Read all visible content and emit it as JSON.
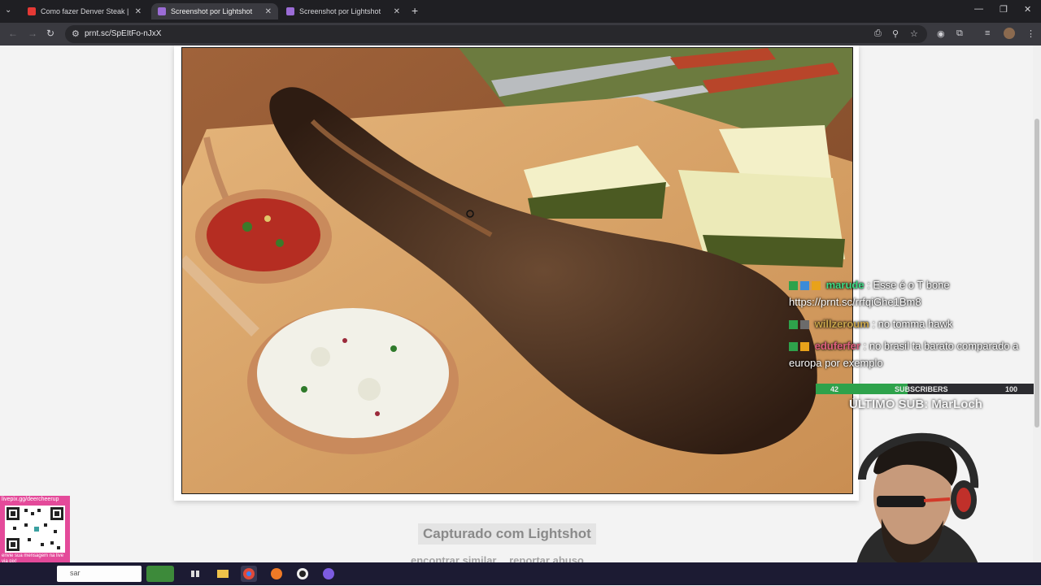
{
  "browser": {
    "tabs": [
      {
        "title": "Como fazer Denver Steak | Netf",
        "favicon_color": "#e53935",
        "active": false
      },
      {
        "title": "Screenshot por Lightshot",
        "favicon_color": "#9b6cd6",
        "active": true
      },
      {
        "title": "Screenshot por Lightshot",
        "favicon_color": "#9b6cd6",
        "active": false
      }
    ],
    "tab_close": "✕",
    "new_tab": "+",
    "window_controls": {
      "minimize": "—",
      "restore": "❐",
      "close": "✕"
    },
    "url": "prnt.sc/SpEItFo-nJxX"
  },
  "page": {
    "caption": "Capturado com Lightshot",
    "links": [
      "encontrar similar",
      "reportar abuso"
    ]
  },
  "stream": {
    "chat": [
      {
        "user": "marude",
        "user_color": "#3ddc84",
        "text": " : Esse é o T bone"
      },
      {
        "user": "",
        "user_color": "#ffffff",
        "text": "https://prnt.sc/rrfqiGhe1Bm8"
      },
      {
        "user": "willzeroum",
        "user_color": "#c9a54a",
        "text": " : no tomma hawk"
      },
      {
        "user": "eduferfer",
        "user_color": "#e0607e",
        "text": " : no brasil ta barato comparado a"
      },
      {
        "user": "",
        "user_color": "#ffffff",
        "text": "europa por exemplo"
      }
    ],
    "subscribers": {
      "current": "42",
      "label": "SUBSCRIBERS",
      "goal": "100",
      "progress": 0.42
    },
    "last_sub": "ÚLTIMO SUB: MarLoch",
    "qr_top": "livepix.gg/deercheerup",
    "qr_bottom": "envie sua mensagem na live via pix!"
  },
  "taskbar": {
    "search_text": "sar"
  }
}
